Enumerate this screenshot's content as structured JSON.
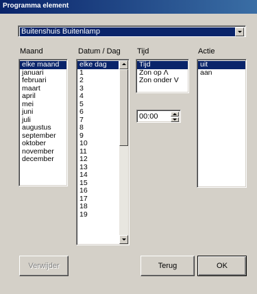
{
  "window": {
    "title": "Programma element"
  },
  "device_combo": {
    "value": "Buitenshuis Buitenlamp"
  },
  "columns": {
    "maand": "Maand",
    "datum": "Datum / Dag",
    "tijd": "Tijd",
    "actie": "Actie"
  },
  "maand_list": [
    "elke maand",
    "januari",
    "februari",
    "maart",
    "april",
    "mei",
    "juni",
    "juli",
    "augustus",
    "september",
    "oktober",
    "november",
    "december"
  ],
  "datum_list": [
    "elke dag",
    "1",
    "2",
    "3",
    "4",
    "5",
    "6",
    "7",
    "8",
    "9",
    "10",
    "11",
    "12",
    "13",
    "14",
    "15",
    "16",
    "17",
    "18",
    "19"
  ],
  "tijd_list": [
    "Tijd",
    "Zon op Λ",
    "Zon onder V"
  ],
  "actie_list": [
    "uit",
    "aan"
  ],
  "time_value": "00:00",
  "buttons": {
    "verwijder": "Verwijder",
    "terug": "Terug",
    "ok": "OK"
  },
  "icons": {
    "dropdown": "chevron-down-icon",
    "scroll_up": "arrow-up-icon",
    "scroll_down": "arrow-down-icon"
  }
}
